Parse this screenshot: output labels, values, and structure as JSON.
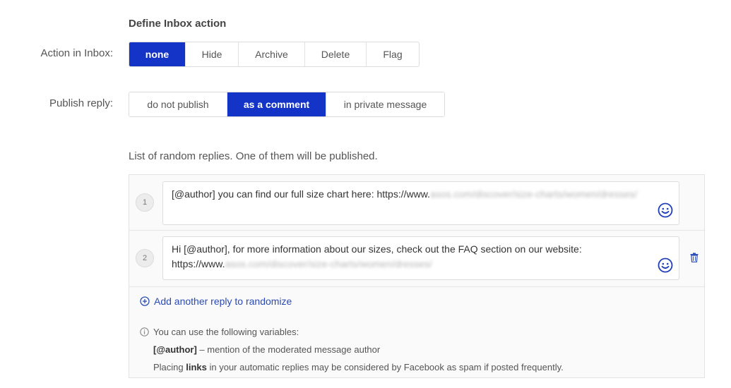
{
  "title": "Define Inbox action",
  "action_in_inbox": {
    "label": "Action in Inbox:",
    "options": [
      "none",
      "Hide",
      "Archive",
      "Delete",
      "Flag"
    ],
    "selected": "none"
  },
  "publish_reply": {
    "label": "Publish reply:",
    "options": [
      "do not publish",
      "as a comment",
      "in private message"
    ],
    "selected": "as a comment"
  },
  "replies_intro": "List of random replies. One of them will be published.",
  "replies": [
    {
      "number": "1",
      "text": "[@author] you can find our full size chart here: https://www.",
      "blurred": "asos.com/discover/size-charts/women/dresses/"
    },
    {
      "number": "2",
      "text": "Hi [@author], for more information about our sizes, check out the FAQ section on our website: https://www.",
      "blurred": "asos.com/discover/size-charts/women/dresses/"
    }
  ],
  "add_reply_label": "Add another reply to randomize",
  "info": {
    "heading": "You can use the following variables:",
    "var_name": "[@author]",
    "var_desc": " – mention of the moderated message author",
    "note_prefix": "Placing ",
    "note_bold": "links",
    "note_suffix": " in your automatic replies may be considered by Facebook as spam if posted frequently."
  },
  "colors": {
    "accent": "#1434c8",
    "link": "#2a4bb5"
  },
  "icons": [
    "smiley-icon",
    "trash-icon",
    "plus-circle-icon",
    "info-icon"
  ]
}
